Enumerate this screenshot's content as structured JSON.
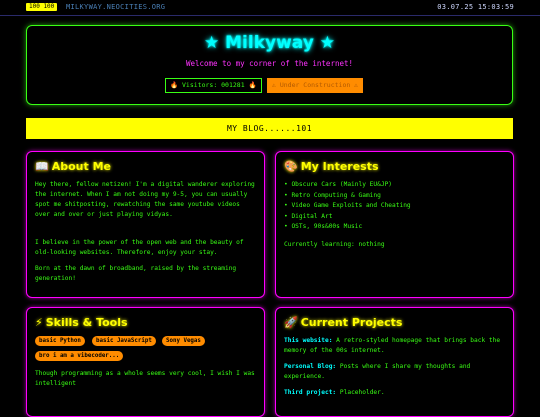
{
  "topbar": {
    "counter": "100 100",
    "site_url": "MILKYWAY.NEOCITIES.ORG",
    "datetime": "03.07.25 15:03:59"
  },
  "header": {
    "title": "★ Milkyway ★",
    "tagline": "Welcome to my corner of the internet!",
    "visitors": "🔥 Visitors: 001281 🔥",
    "construction": "⚠ Under Construction ⚠"
  },
  "blog_banner": "MY BLOG......101",
  "about": {
    "icon": "📖",
    "title": "About Me",
    "paragraphs": [
      "Hey there, fellow netizen! I'm a digital wanderer exploring the internet. When I am not doing my 9-5, you can usually spot me shitposting, rewatching the same youtube videos over and over or just playing vidyas.",
      "I believe in the power of the open web and the beauty of old-looking websites. Therefore, enjoy your stay.",
      "Born at the dawn of broadband, raised by the streaming generation!"
    ]
  },
  "interests": {
    "icon": "🎨",
    "title": "My Interests",
    "items": [
      "Obscure Cars (Mainly EU&JP)",
      "Retro Computing & Gaming",
      "Video Game Exploits and Cheating",
      "Digital Art",
      "OSTs, 90s&00s Music"
    ],
    "currently_learning": "Currently learning: nothing"
  },
  "skills": {
    "icon": "⚡",
    "title": "Skills & Tools",
    "tags": [
      "basic Python",
      "basic JavaScript",
      "Sony Vegas",
      "bro i am a vibecoder..."
    ],
    "text": "Though programming as a whole seems very cool, I wish I was intelligent"
  },
  "projects": {
    "icon": "🚀",
    "title": "Current Projects",
    "items": [
      {
        "label": "This website:",
        "text": "A retro-styled homepage that brings back the memory of the 00s internet."
      },
      {
        "label": "Personal Blog:",
        "text": "Posts where I share my thoughts and experience."
      },
      {
        "label": "Third project:",
        "text": "Placeholder."
      }
    ]
  },
  "colors": {
    "background": "#000000",
    "text_green": "#39ff14",
    "title_cyan": "#00ffff",
    "heading_yellow": "#ffff00",
    "panel_border_magenta": "#ff00ff",
    "tag_orange": "#ff8c00"
  }
}
